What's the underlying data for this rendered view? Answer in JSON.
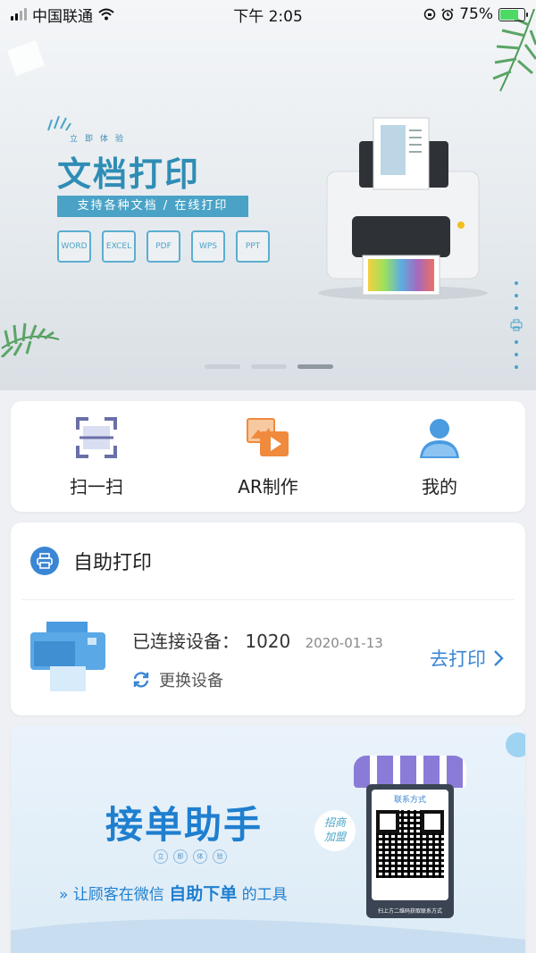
{
  "status_bar": {
    "carrier": "中国联通",
    "time": "下午 2:05",
    "battery": "75%"
  },
  "banner": {
    "subtitle": "立即体验",
    "title": "文档打印",
    "tagline": "支持各种文档 / 在线打印",
    "formats": [
      "WORD",
      "EXCEL",
      "PDF",
      "WPS",
      "PPT"
    ]
  },
  "quick_actions": [
    {
      "label": "扫一扫",
      "icon": "scan-icon"
    },
    {
      "label": "AR制作",
      "icon": "ar-media-icon"
    },
    {
      "label": "我的",
      "icon": "user-icon"
    }
  ],
  "self_print": {
    "title": "自助打印",
    "connected_label": "已连接设备：",
    "device_id": "1020",
    "date": "2020-01-13",
    "change_device": "更换设备",
    "go_print": "去打印"
  },
  "promo": {
    "title": "接单助手",
    "tiny_chars": [
      "立",
      "即",
      "体",
      "验"
    ],
    "line_prefix": "»  让顾客在微信",
    "line_bold": "自助下单",
    "line_suffix": "的工具",
    "badge": "招商\n加盟",
    "qr_title": "联系方式",
    "qr_caption": "扫上方二维码获取联系方式"
  },
  "colors": {
    "accent": "#3a86d4",
    "banner_title": "#2f8db5"
  }
}
